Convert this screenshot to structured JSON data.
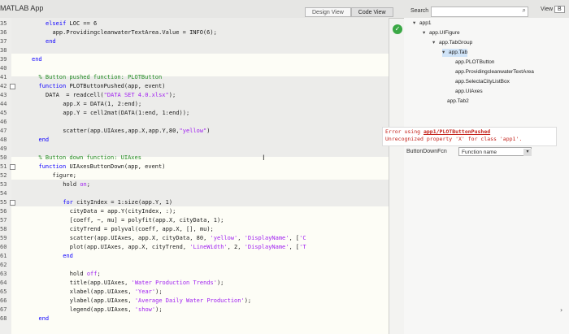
{
  "window": {
    "app_title": "MATLAB App"
  },
  "view_toggle": {
    "design": "Design View",
    "code": "Code View"
  },
  "editor": {
    "lines": [
      {
        "n": "35",
        "indent": 8,
        "parts": [
          {
            "t": "elseif LOC == 6",
            "c": "kw-first"
          }
        ]
      },
      {
        "n": "36",
        "indent": 10,
        "parts": [
          {
            "t": "app.ProvidingcleanwaterTextArea.Value = INFO(6);",
            "c": ""
          }
        ]
      },
      {
        "n": "37",
        "indent": 8,
        "parts": [
          {
            "t": "end",
            "c": "kw"
          }
        ]
      },
      {
        "n": "38",
        "indent": 0,
        "parts": []
      },
      {
        "n": "39",
        "indent": 4,
        "parts": [
          {
            "t": "end",
            "c": "kw"
          }
        ]
      },
      {
        "n": "40",
        "indent": 0,
        "parts": []
      },
      {
        "n": "41",
        "indent": 6,
        "parts": [
          {
            "t": "% Button pushed function: PLOTButton",
            "c": "cm"
          }
        ]
      },
      {
        "n": "42",
        "indent": 6,
        "parts": [
          {
            "t": "function ",
            "c": "kw"
          },
          {
            "t": "PLOTButtonPushed(app, event)",
            "c": ""
          }
        ]
      },
      {
        "n": "43",
        "indent": 8,
        "parts": [
          {
            "t": "DATA  = readcell(",
            "c": ""
          },
          {
            "t": "\"DATA SET 4.0.xlsx\"",
            "c": "st"
          },
          {
            "t": ");",
            "c": ""
          }
        ]
      },
      {
        "n": "44",
        "indent": 13,
        "parts": [
          {
            "t": "app.X = DATA(1, 2:end);",
            "c": ""
          }
        ]
      },
      {
        "n": "45",
        "indent": 13,
        "parts": [
          {
            "t": "app.Y = cell2mat(DATA(1:end, 1:end));",
            "c": ""
          }
        ]
      },
      {
        "n": "46",
        "indent": 0,
        "parts": []
      },
      {
        "n": "47",
        "indent": 13,
        "parts": [
          {
            "t": "scatter(app.UIAxes,app.X,app.Y,80,",
            "c": ""
          },
          {
            "t": "\"yellow\"",
            "c": "st"
          },
          {
            "t": ")",
            "c": ""
          }
        ]
      },
      {
        "n": "48",
        "indent": 6,
        "parts": [
          {
            "t": "end",
            "c": "kw"
          }
        ]
      },
      {
        "n": "49",
        "indent": 0,
        "parts": []
      },
      {
        "n": "50",
        "indent": 6,
        "parts": [
          {
            "t": "% Button down function: UIAxes",
            "c": "cm"
          }
        ]
      },
      {
        "n": "51",
        "indent": 6,
        "parts": [
          {
            "t": "function ",
            "c": "kw"
          },
          {
            "t": "UIAxesButtonDown(app, event)",
            "c": ""
          }
        ]
      },
      {
        "n": "52",
        "indent": 10,
        "parts": [
          {
            "t": "figure;",
            "c": ""
          }
        ]
      },
      {
        "n": "53",
        "indent": 13,
        "parts": [
          {
            "t": "hold ",
            "c": ""
          },
          {
            "t": "on",
            "c": "st"
          },
          {
            "t": ";",
            "c": ""
          }
        ]
      },
      {
        "n": "54",
        "indent": 0,
        "parts": []
      },
      {
        "n": "55",
        "indent": 13,
        "parts": [
          {
            "t": "for ",
            "c": "kw"
          },
          {
            "t": "cityIndex = 1:size(app.Y, 1)",
            "c": ""
          }
        ]
      },
      {
        "n": "56",
        "indent": 15,
        "parts": [
          {
            "t": "cityData = app.Y(cityIndex, :);",
            "c": ""
          }
        ]
      },
      {
        "n": "57",
        "indent": 15,
        "parts": [
          {
            "t": "[coeff, ~, mu] = polyfit(app.X, cityData, 1);",
            "c": ""
          }
        ]
      },
      {
        "n": "58",
        "indent": 15,
        "parts": [
          {
            "t": "cityTrend = polyval(coeff, app.X, [], mu);",
            "c": ""
          }
        ]
      },
      {
        "n": "59",
        "indent": 15,
        "parts": [
          {
            "t": "scatter(app.UIAxes, app.X, cityData, 80, ",
            "c": ""
          },
          {
            "t": "'yellow'",
            "c": "st"
          },
          {
            "t": ", ",
            "c": ""
          },
          {
            "t": "'DisplayName'",
            "c": "st"
          },
          {
            "t": ", [",
            "c": ""
          },
          {
            "t": "'C",
            "c": "st"
          }
        ]
      },
      {
        "n": "60",
        "indent": 15,
        "parts": [
          {
            "t": "plot(app.UIAxes, app.X, cityTrend, ",
            "c": ""
          },
          {
            "t": "'LineWidth'",
            "c": "st"
          },
          {
            "t": ", 2, ",
            "c": ""
          },
          {
            "t": "'DisplayName'",
            "c": "st"
          },
          {
            "t": ", [",
            "c": ""
          },
          {
            "t": "'T",
            "c": "st"
          }
        ]
      },
      {
        "n": "61",
        "indent": 13,
        "parts": [
          {
            "t": "end",
            "c": "kw"
          }
        ]
      },
      {
        "n": "62",
        "indent": 0,
        "parts": []
      },
      {
        "n": "63",
        "indent": 15,
        "parts": [
          {
            "t": "hold ",
            "c": ""
          },
          {
            "t": "off",
            "c": "st"
          },
          {
            "t": ";",
            "c": ""
          }
        ]
      },
      {
        "n": "64",
        "indent": 15,
        "parts": [
          {
            "t": "title(app.UIAxes, ",
            "c": ""
          },
          {
            "t": "'Water Production Trends'",
            "c": "st"
          },
          {
            "t": ");",
            "c": ""
          }
        ]
      },
      {
        "n": "65",
        "indent": 15,
        "parts": [
          {
            "t": "xlabel(app.UIAxes, ",
            "c": ""
          },
          {
            "t": "'Year'",
            "c": "st"
          },
          {
            "t": ");",
            "c": ""
          }
        ]
      },
      {
        "n": "66",
        "indent": 15,
        "parts": [
          {
            "t": "ylabel(app.UIAxes, ",
            "c": ""
          },
          {
            "t": "'Average Daily Water Production'",
            "c": "st"
          },
          {
            "t": ");",
            "c": ""
          }
        ]
      },
      {
        "n": "67",
        "indent": 15,
        "parts": [
          {
            "t": "legend(app.UIAxes, ",
            "c": ""
          },
          {
            "t": "'show'",
            "c": "st"
          },
          {
            "t": ");",
            "c": ""
          }
        ]
      },
      {
        "n": "68",
        "indent": 6,
        "parts": [
          {
            "t": "end",
            "c": "kw"
          }
        ]
      }
    ]
  },
  "search": {
    "label": "Search",
    "placeholder": "",
    "view_label": "View",
    "view_value": "B"
  },
  "tree": [
    {
      "label": "app1",
      "level": 0,
      "twisty": "▾"
    },
    {
      "label": "app.UIFigure",
      "level": 1,
      "twisty": "▾"
    },
    {
      "label": "app.TabGroup",
      "level": 2,
      "twisty": "▾"
    },
    {
      "label": "app.Tab",
      "level": 3,
      "twisty": "▾",
      "selected": true
    },
    {
      "label": "app.PLOTButton",
      "level": 4,
      "twisty": ""
    },
    {
      "label": "app.ProvidingcleanwaterTextArea",
      "level": 4,
      "twisty": ""
    },
    {
      "label": "app.SelectaCityListBox",
      "level": 4,
      "twisty": ""
    },
    {
      "label": "app.UIAxes",
      "level": 4,
      "twisty": ""
    },
    {
      "label": "app.Tab2",
      "level": 3,
      "twisty": ""
    }
  ],
  "error": {
    "prefix": "Error using ",
    "link": "app1/PLOTButtonPushed",
    "line2": "Unrecognized property 'X' for class 'app1'."
  },
  "callback": {
    "label": "ButtonDownFcn",
    "value": "Function name"
  }
}
